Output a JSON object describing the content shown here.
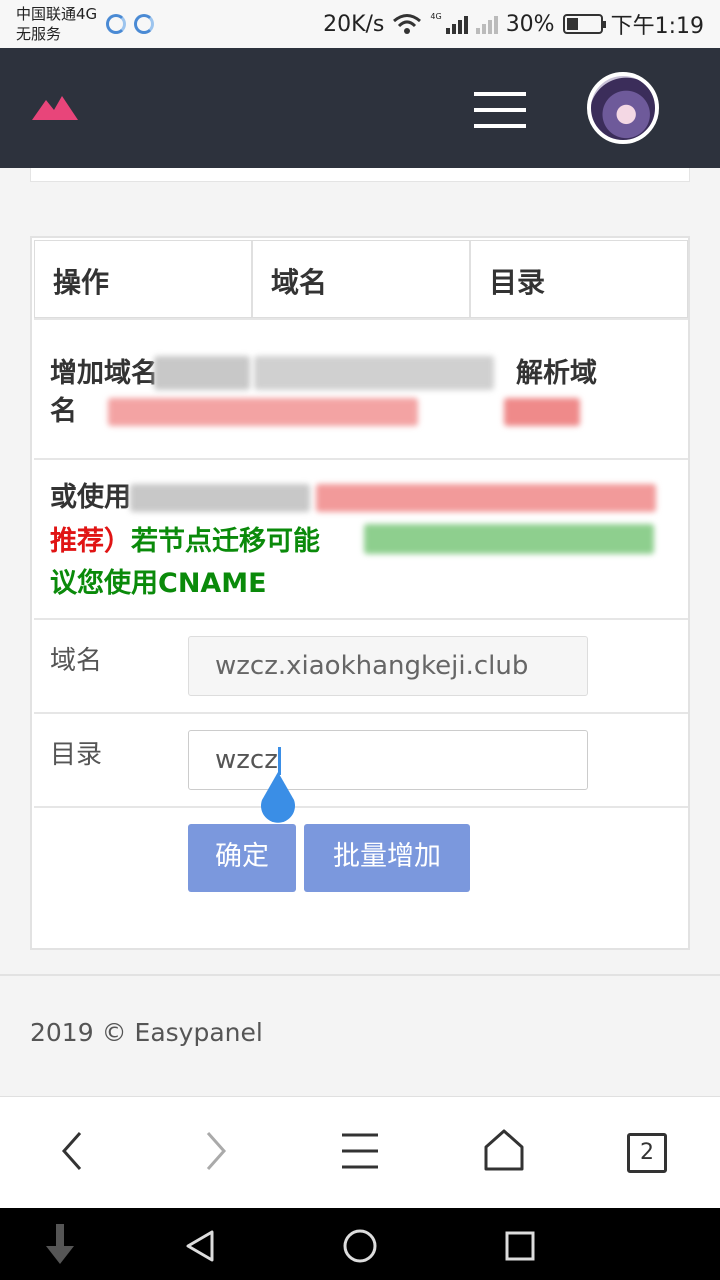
{
  "status_bar": {
    "carrier_line1": "中国联通4G",
    "carrier_line2": "无服务",
    "speed": "20K/s",
    "net_badge": "4G",
    "battery": "30%",
    "time": "下午1:19"
  },
  "header": {
    "logo_icon": "mountain-logo",
    "menu_icon": "hamburger-icon",
    "avatar_icon": "user-avatar"
  },
  "table": {
    "columns": [
      "操作",
      "域名",
      "目录"
    ]
  },
  "notice": {
    "line1_start": "增加域名",
    "line1_end": "解析域",
    "line2_start": "名",
    "line3_start": "或使用",
    "line4_red": "推荐）",
    "line4_green": "若节点迁移可能",
    "line5_green": "议您使用CNAME"
  },
  "form": {
    "domain_label": "域名",
    "domain_value": "wzcz.xiaokhangkeji.club",
    "dir_label": "目录",
    "dir_value": "wzcz",
    "confirm_label": "确定",
    "batch_label": "批量增加"
  },
  "footer": {
    "copyright": "2019 © Easypanel"
  },
  "browser": {
    "tab_count": "2"
  },
  "colors": {
    "header_bg": "#2d323d",
    "accent_pink": "#e8457a",
    "button_blue": "#7b98dd",
    "warn_red": "#e01414",
    "ok_green": "#0a8a0a"
  }
}
